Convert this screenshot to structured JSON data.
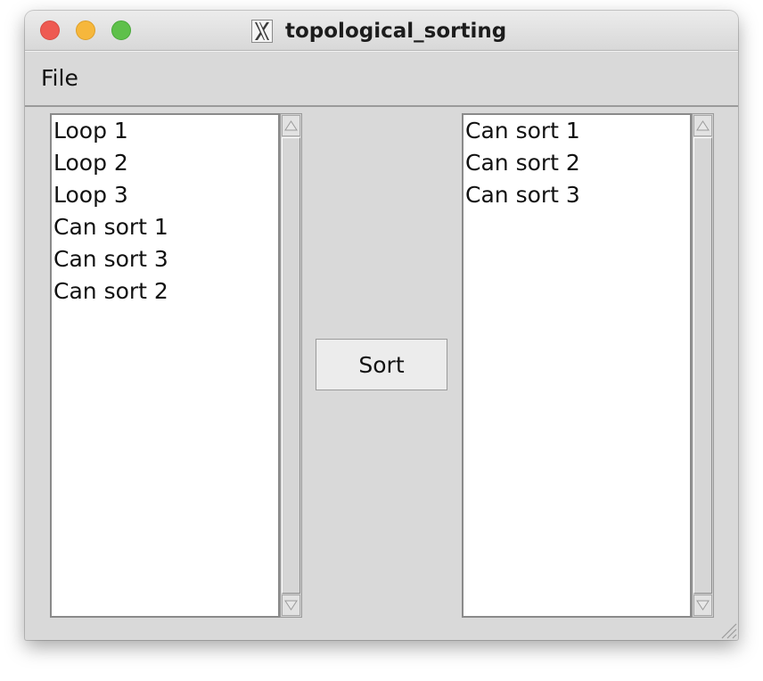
{
  "window": {
    "title": "topological_sorting"
  },
  "menubar": {
    "file_label": "File"
  },
  "left_list": {
    "items": [
      "Loop 1",
      "Loop 2",
      "Loop 3",
      "Can sort 1",
      "Can sort 3",
      "Can sort 2"
    ]
  },
  "right_list": {
    "items": [
      "Can sort 1",
      "Can sort 2",
      "Can sort 3"
    ]
  },
  "actions": {
    "sort_label": "Sort"
  },
  "icons": {
    "app_icon": "x11-icon",
    "window_controls": [
      "close",
      "minimize",
      "maximize"
    ]
  },
  "colors": {
    "close": "#ee5a52",
    "minimize": "#f6b73c",
    "maximize": "#5ec04a",
    "window_bg": "#d9d9d9",
    "list_bg": "#ffffff"
  }
}
